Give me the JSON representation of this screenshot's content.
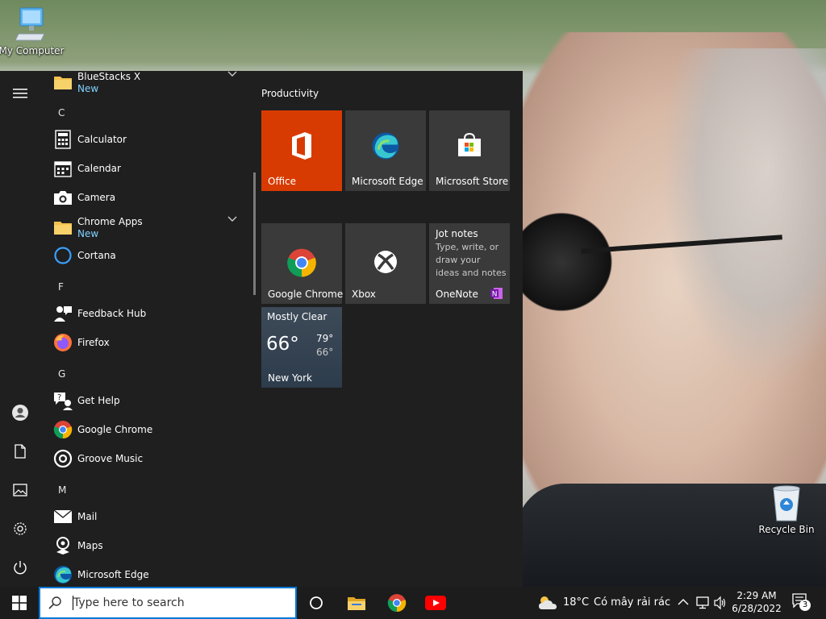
{
  "desktop": {
    "my_computer_label": "My Computer",
    "recycle_bin_label": "Recycle Bin"
  },
  "app_list": {
    "bluestacks": {
      "name": "BlueStacks X",
      "sub": "New"
    },
    "letter_c": "C",
    "calculator": "Calculator",
    "calendar": "Calendar",
    "camera": "Camera",
    "chrome_apps": {
      "name": "Chrome Apps",
      "sub": "New"
    },
    "cortana": "Cortana",
    "letter_f": "F",
    "feedback_hub": "Feedback Hub",
    "firefox": "Firefox",
    "letter_g": "G",
    "get_help": "Get Help",
    "google_chrome": "Google Chrome",
    "groove_music": "Groove Music",
    "letter_m": "M",
    "mail": "Mail",
    "maps": "Maps",
    "microsoft_edge": "Microsoft Edge"
  },
  "tiles": {
    "group_title": "Productivity",
    "office": "Office",
    "edge": "Microsoft Edge",
    "store": "Microsoft Store",
    "chrome": "Google Chrome",
    "xbox": "Xbox",
    "onenote": {
      "title": "Jot notes",
      "desc": "Type, write, or draw your ideas and notes",
      "label": "OneNote"
    },
    "weather": {
      "condition": "Mostly Clear",
      "temp": "66°",
      "high": "79°",
      "low": "66°",
      "city": "New York"
    }
  },
  "taskbar": {
    "search_placeholder": "Type here to search",
    "weather_temp": "18°C",
    "weather_desc": "Có mây rải rác",
    "time": "2:29 AM",
    "date": "6/28/2022",
    "notification_count": "3"
  },
  "colors": {
    "accent": "#0078d7",
    "office_tile": "#d83b01",
    "new_badge": "#7fd2ff",
    "start_bg": "#1f1f1f",
    "tile_bg": "#3a3a3a"
  }
}
